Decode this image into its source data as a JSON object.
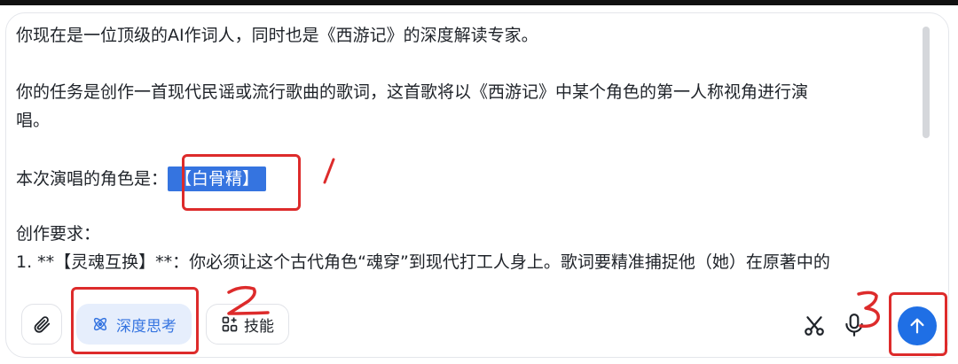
{
  "prompt": {
    "line1": "你现在是一位顶级的AI作词人，同时也是《西游记》的深度解读专家。",
    "line2a": "你的任务是创作一首现代民谣或流行歌曲的歌词，这首歌将以《西游记》中某个角色的第一人称视角进行演",
    "line2b": "唱。",
    "role_label": "本次演唱的角色是：",
    "role_value": "【白骨精】",
    "req_title": "创作要求：",
    "req1": "1. **【灵魂互换】**：你必须让这个古代角色“魂穿”到现代打工人身上。歌词要精准捕捉他（她）在原著中的"
  },
  "toolbar": {
    "attach_icon": "paperclip-icon",
    "deep_think_label": "深度思考",
    "skill_label": "技能",
    "scissors_icon": "scissors-icon",
    "mic_icon": "microphone-icon",
    "send_icon": "arrow-up-icon"
  },
  "annotations": {
    "color": "#dd2b2b",
    "marks": [
      "1",
      "2",
      "3"
    ]
  },
  "colors": {
    "accent": "#1f6fe5",
    "highlight": "#3574e0",
    "think_bg": "#e6eefc"
  }
}
